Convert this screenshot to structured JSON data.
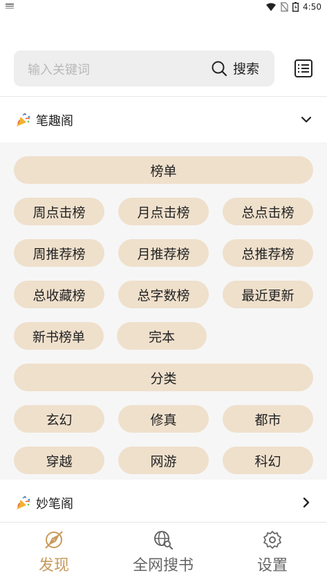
{
  "status_bar": {
    "time": "4:50"
  },
  "search": {
    "placeholder": "输入关键词",
    "button_label": "搜索"
  },
  "sources": [
    {
      "name": "笔趣阁",
      "sections": [
        {
          "title": "榜单",
          "items": [
            "周点击榜",
            "月点击榜",
            "总点击榜",
            "周推荐榜",
            "月推荐榜",
            "总推荐榜",
            "总收藏榜",
            "总字数榜",
            "最近更新",
            "新书榜单",
            "完本"
          ]
        },
        {
          "title": "分类",
          "items": [
            "玄幻",
            "修真",
            "都市",
            "穿越",
            "网游",
            "科幻"
          ]
        }
      ]
    },
    {
      "name": "妙笔阁"
    }
  ],
  "bottom_nav": [
    {
      "label": "发现",
      "icon": "compass-icon",
      "active": true
    },
    {
      "label": "全网搜书",
      "icon": "globe-search-icon",
      "active": false
    },
    {
      "label": "设置",
      "icon": "gear-icon",
      "active": false
    }
  ],
  "colors": {
    "accent": "#c89a5b",
    "pill": "#efe0cc",
    "panel": "#f6f6f6"
  }
}
